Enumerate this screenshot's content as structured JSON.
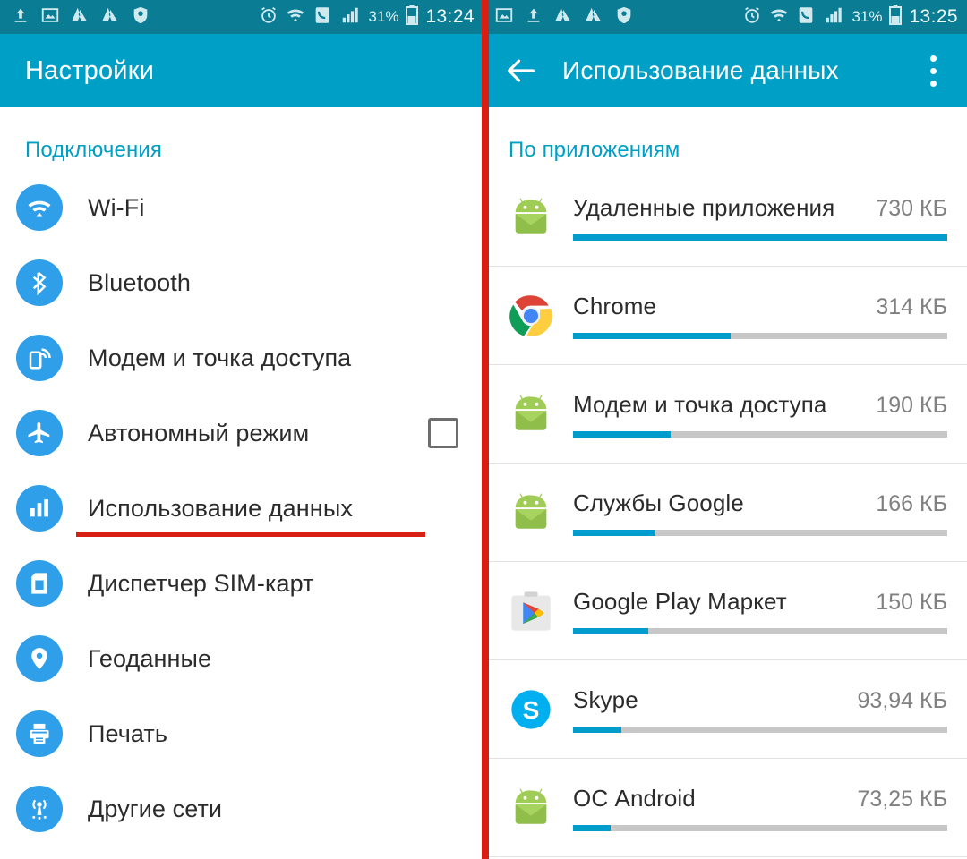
{
  "colors": {
    "status_bar": "#0a7d94",
    "action_bar": "#00a0c6",
    "accent": "#00a0c6",
    "divider_red": "#d81f14",
    "bar_fill": "#009ccc",
    "bar_track": "#c7c7c7",
    "icon_blue": "#2e9fe8"
  },
  "left": {
    "statusbar": {
      "icons": [
        "upload-icon",
        "image-icon",
        "drive-icon",
        "drive-icon",
        "antivirus-icon"
      ],
      "right_icons": [
        "alarm-icon",
        "wifi-icon",
        "phone-icon",
        "signal-icon"
      ],
      "battery_percent": "31%",
      "battery_icon": "battery-icon",
      "clock": "13:24"
    },
    "action_bar": {
      "title": "Настройки"
    },
    "section_title": "Подключения",
    "items": [
      {
        "label": "Wi-Fi",
        "icon": "wifi-icon",
        "checkbox": false,
        "underlined": false
      },
      {
        "label": "Bluetooth",
        "icon": "bluetooth-icon",
        "checkbox": false,
        "underlined": false
      },
      {
        "label": "Модем и точка доступа",
        "icon": "tethering-icon",
        "checkbox": false,
        "underlined": false
      },
      {
        "label": "Автономный режим",
        "icon": "airplane-icon",
        "checkbox": true,
        "underlined": false
      },
      {
        "label": "Использование данных",
        "icon": "data-usage-icon",
        "checkbox": false,
        "underlined": true
      },
      {
        "label": "Диспетчер SIM-карт",
        "icon": "sim-card-icon",
        "checkbox": false,
        "underlined": false
      },
      {
        "label": "Геоданные",
        "icon": "location-pin-icon",
        "checkbox": false,
        "underlined": false
      },
      {
        "label": "Печать",
        "icon": "printer-icon",
        "checkbox": false,
        "underlined": false
      },
      {
        "label": "Другие сети",
        "icon": "broadcast-icon",
        "checkbox": false,
        "underlined": false
      }
    ]
  },
  "right": {
    "statusbar": {
      "icons": [
        "image-icon",
        "upload-icon",
        "drive-icon",
        "drive-icon",
        "antivirus-icon"
      ],
      "right_icons": [
        "alarm-icon",
        "wifi-icon",
        "phone-icon",
        "signal-icon"
      ],
      "battery_percent": "31%",
      "battery_icon": "battery-icon",
      "clock": "13:25"
    },
    "action_bar": {
      "back_icon": "back-arrow-icon",
      "title": "Использование данных",
      "overflow_icon": "overflow-menu-icon"
    },
    "section_title": "По приложениям",
    "apps": [
      {
        "name": "Удаленные приложения",
        "size": "730 КБ",
        "icon": "android-robot-icon",
        "percent": 100
      },
      {
        "name": "Chrome",
        "size": "314 КБ",
        "icon": "chrome-icon",
        "percent": 42
      },
      {
        "name": "Модем и точка доступа",
        "size": "190 КБ",
        "icon": "android-robot-icon",
        "percent": 26
      },
      {
        "name": "Службы Google",
        "size": "166 КБ",
        "icon": "android-robot-icon",
        "percent": 22
      },
      {
        "name": "Google Play Маркет",
        "size": "150 КБ",
        "icon": "play-store-icon",
        "percent": 20
      },
      {
        "name": "Skype",
        "size": "93,94 КБ",
        "icon": "skype-icon",
        "percent": 13
      },
      {
        "name": "ОС Android",
        "size": "73,25 КБ",
        "icon": "android-robot-icon",
        "percent": 10
      }
    ]
  },
  "chart_data": {
    "type": "bar",
    "title": "По приложениям",
    "categories": [
      "Удаленные приложения",
      "Chrome",
      "Модем и точка доступа",
      "Службы Google",
      "Google Play Маркет",
      "Skype",
      "ОС Android"
    ],
    "values": [
      730,
      314,
      190,
      166,
      150,
      93.94,
      73.25
    ],
    "value_labels": [
      "730 КБ",
      "314 КБ",
      "190 КБ",
      "166 КБ",
      "150 КБ",
      "93,94 КБ",
      "73,25 КБ"
    ],
    "bar_percents": [
      100,
      42,
      26,
      22,
      20,
      13,
      10
    ],
    "unit": "КБ",
    "xlabel": "",
    "ylabel": "",
    "ylim": [
      0,
      730
    ],
    "grid": false,
    "legend": false
  }
}
